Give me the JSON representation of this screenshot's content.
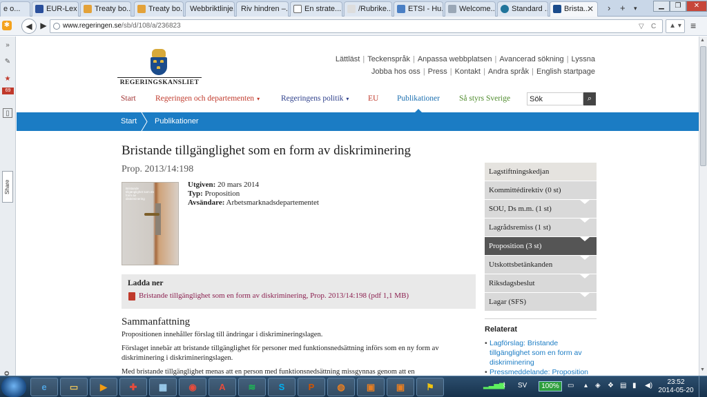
{
  "browser": {
    "tabs": [
      {
        "label": "e o..."
      },
      {
        "label": "EUR-Lex -..."
      },
      {
        "label": "Treaty bo..."
      },
      {
        "label": "Treaty bo..."
      },
      {
        "label": "Webbriktlinje..."
      },
      {
        "label": "Riv hindren –..."
      },
      {
        "label": "En strate..."
      },
      {
        "label": "/Rubrike..."
      },
      {
        "label": "ETSI - Hu..."
      },
      {
        "label": "Welcome..."
      },
      {
        "label": "Standard ..."
      },
      {
        "label": "Brista..."
      }
    ],
    "new_tab": "+",
    "url_host": "www.regeringen.se",
    "url_path": "/sb/d/108/a/236823"
  },
  "leftbar": {
    "badge": "69",
    "share": "Share",
    "yoono": "yoono"
  },
  "site": {
    "logo_text": "REGERINGSKANSLIET",
    "top_links_row1": [
      "Lättläst",
      "Teckenspråk",
      "Anpassa webbplatsen",
      "Avancerad sökning",
      "Lyssna"
    ],
    "top_links_row2": [
      "Jobba hos oss",
      "Press",
      "Kontakt",
      "Andra språk",
      "English startpage"
    ],
    "main_nav": [
      {
        "label": "Start",
        "color": "#a03030"
      },
      {
        "label": "Regeringen och departementen",
        "color": "#c0392b",
        "caret": "▾"
      },
      {
        "label": "Regeringens politik",
        "color": "#2c3e8a",
        "caret": "▾"
      },
      {
        "label": "EU",
        "color": "#c0392b"
      },
      {
        "label": "Publikationer",
        "color": "#1b6fb0"
      },
      {
        "label": "Så styrs Sverige",
        "color": "#4d8a2a"
      }
    ],
    "search_value": "Sök",
    "breadcrumb": [
      "Start",
      "Publikationer"
    ]
  },
  "document": {
    "title": "Bristande tillgänglighet som en form av diskriminering",
    "subtitle": "Prop. 2013/14:198",
    "cover_text": "Bristande tillgänglighet som en form av diskriminering",
    "meta": [
      {
        "label": "Utgiven:",
        "value": "20 mars 2014"
      },
      {
        "label": "Typ:",
        "value": "Proposition"
      },
      {
        "label": "Avsändare:",
        "value": "Arbetsmarknadsdepartementet"
      }
    ],
    "download_heading": "Ladda ner",
    "download_link": "Bristande tillgänglighet som en form av diskriminering, Prop. 2013/14:198 (pdf 1,1 MB)",
    "summary_heading": "Sammanfattning",
    "paragraphs": [
      "Propositionen innehåller förslag till ändringar i diskrimineringslagen.",
      "Förslaget innebär att bristande tillgänglighet för personer med funktionsnedsättning införs som en ny form av diskriminering i diskrimineringslagen.",
      "Med bristande tillgänglighet menas att en person med funktionsnedsättning missgynnas genom att en"
    ]
  },
  "process": [
    {
      "label": "Lagstiftningskedjan",
      "arrow": false,
      "active": false
    },
    {
      "label": "Kommittédirektiv (0 st)",
      "arrow": false,
      "active": false
    },
    {
      "label": "SOU, Ds m.m. (1 st)",
      "arrow": true,
      "active": false
    },
    {
      "label": "Lagrådsremiss (1 st)",
      "arrow": true,
      "active": false
    },
    {
      "label": "Proposition (3 st)",
      "arrow": true,
      "active": true
    },
    {
      "label": "Utskottsbetänkanden",
      "arrow": true,
      "active": false
    },
    {
      "label": "Riksdagsbeslut",
      "arrow": true,
      "active": false
    },
    {
      "label": "Lagar (SFS)",
      "arrow": true,
      "active": false
    }
  ],
  "related": {
    "heading": "Relaterat",
    "items": [
      "Lagförslag: Bristande tillgänglighet som en form av diskriminering",
      "Pressmeddelande: Proposition"
    ]
  },
  "taskbar": {
    "battery": "100%",
    "lang": "SV",
    "time": "23:52",
    "date": "2014-05-20"
  }
}
